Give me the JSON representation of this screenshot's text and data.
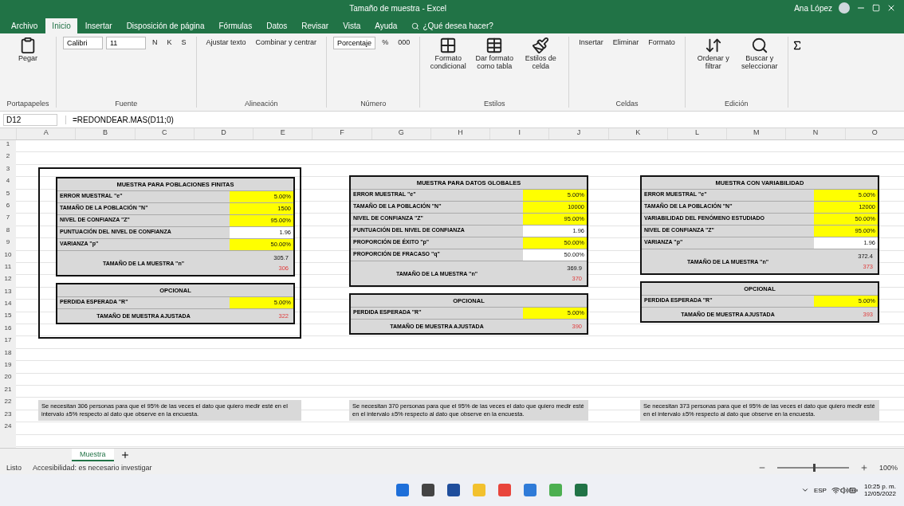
{
  "window": {
    "title": "Tamaño de muestra - Excel",
    "user": "Ana López"
  },
  "menu_tabs": [
    {
      "label": "Archivo",
      "selected": false
    },
    {
      "label": "Inicio",
      "selected": true
    },
    {
      "label": "Insertar",
      "selected": false
    },
    {
      "label": "Disposición de página",
      "selected": false
    },
    {
      "label": "Fórmulas",
      "selected": false
    },
    {
      "label": "Datos",
      "selected": false
    },
    {
      "label": "Revisar",
      "selected": false
    },
    {
      "label": "Vista",
      "selected": false
    },
    {
      "label": "Ayuda",
      "selected": false
    }
  ],
  "tell_me": "¿Qué desea hacer?",
  "ribbon": [
    {
      "label": "Portapapeles",
      "items": [
        {
          "kind": "big",
          "label": "Pegar"
        }
      ]
    },
    {
      "label": "Fuente",
      "items": [
        {
          "kind": "field",
          "label": "Calibri"
        },
        {
          "kind": "field",
          "label": "11"
        },
        {
          "kind": "small",
          "label": "N"
        },
        {
          "kind": "small",
          "label": "K"
        },
        {
          "kind": "small",
          "label": "S"
        }
      ]
    },
    {
      "label": "Alineación",
      "items": [
        {
          "kind": "small",
          "label": "Ajustar texto"
        },
        {
          "kind": "small",
          "label": "Combinar y centrar"
        }
      ]
    },
    {
      "label": "Número",
      "items": [
        {
          "kind": "field",
          "label": "Porcentaje"
        },
        {
          "kind": "small",
          "label": "%"
        },
        {
          "kind": "small",
          "label": "000"
        }
      ]
    },
    {
      "label": "Estilos",
      "items": [
        {
          "kind": "big",
          "label": "Formato condicional"
        },
        {
          "kind": "big",
          "label": "Dar formato como tabla"
        },
        {
          "kind": "big",
          "label": "Estilos de celda"
        }
      ]
    },
    {
      "label": "Celdas",
      "items": [
        {
          "kind": "small",
          "label": "Insertar"
        },
        {
          "kind": "small",
          "label": "Eliminar"
        },
        {
          "kind": "small",
          "label": "Formato"
        }
      ]
    },
    {
      "label": "Edición",
      "items": [
        {
          "kind": "big",
          "label": "Ordenar y filtrar"
        },
        {
          "kind": "big",
          "label": "Buscar y seleccionar"
        }
      ]
    }
  ],
  "formula_bar": {
    "cell": "D12",
    "formula": "=REDONDEAR.MAS(D11;0)"
  },
  "columns": [
    "A",
    "B",
    "C",
    "D",
    "E",
    "F",
    "G",
    "H",
    "I",
    "J",
    "K",
    "L",
    "M",
    "N",
    "O"
  ],
  "rows": [
    "1",
    "2",
    "3",
    "4",
    "5",
    "6",
    "7",
    "8",
    "9",
    "10",
    "11",
    "12",
    "13",
    "14",
    "15",
    "16",
    "17",
    "18",
    "19",
    "20",
    "21",
    "22",
    "23",
    "24"
  ],
  "tables": [
    {
      "framed": true,
      "title": "MUESTRA PARA POBLACIONES FINITAS",
      "rows": [
        {
          "label": "ERROR MUESTRAL \"e\"",
          "value": "5.00%",
          "kind": "input"
        },
        {
          "label": "TAMAÑO DE LA POBLACIÓN \"N\"",
          "value": "1500",
          "kind": "input"
        },
        {
          "label": "NIVEL DE CONFIANZA \"Z\"",
          "value": "95.00%",
          "kind": "input"
        },
        {
          "label": "PUNTUACIÓN DEL NIVEL DE CONFIANZA",
          "value": "1.96",
          "kind": "plain"
        },
        {
          "label": "VARIANZA \"p\"",
          "value": "50.00%",
          "kind": "input"
        }
      ],
      "result": {
        "label": "TAMAÑO DE LA MUESTRA \"n\"",
        "values": [
          "305.7",
          "306"
        ]
      },
      "optional": {
        "title": "OPCIONAL",
        "rows": [
          {
            "label": "PERDIDA ESPERADA \"R\"",
            "value": "5.00%",
            "kind": "input"
          }
        ],
        "result": {
          "label": "TAMAÑO DE MUESTRA AJUSTADA",
          "values": [
            "322"
          ]
        }
      },
      "note": "Se necesitan 306 personas para que el 95% de las veces el dato que quiero medir esté en el intervalo ±5% respecto al dato que observe en la encuesta."
    },
    {
      "framed": false,
      "title": "MUESTRA PARA DATOS GLOBALES",
      "rows": [
        {
          "label": "ERROR MUESTRAL \"e\"",
          "value": "5.00%",
          "kind": "input"
        },
        {
          "label": "TAMAÑO DE LA POBLACIÓN \"N\"",
          "value": "10000",
          "kind": "input"
        },
        {
          "label": "NIVEL DE CONFIANZA \"Z\"",
          "value": "95.00%",
          "kind": "input"
        },
        {
          "label": "PUNTUACIÓN DEL NIVEL DE CONFIANZA",
          "value": "1.96",
          "kind": "plain"
        },
        {
          "label": "PROPORCIÓN DE ÉXITO \"p\"",
          "value": "50.00%",
          "kind": "input"
        },
        {
          "label": "PROPORCIÓN DE FRACASO \"q\"",
          "value": "50.00%",
          "kind": "plain"
        }
      ],
      "result": {
        "label": "TAMAÑO DE LA MUESTRA \"n\"",
        "values": [
          "369.9",
          "370"
        ]
      },
      "optional": {
        "title": "OPCIONAL",
        "rows": [
          {
            "label": "PERDIDA ESPERADA \"R\"",
            "value": "5.00%",
            "kind": "input"
          }
        ],
        "result": {
          "label": "TAMAÑO DE MUESTRA AJUSTADA",
          "values": [
            "390"
          ]
        }
      },
      "note": "Se necesitan 370 personas para que el 95% de las veces el dato que quiero medir esté en el intervalo ±5% respecto al dato que observe en la encuesta."
    },
    {
      "framed": false,
      "title": "MUESTRA CON VARIABILIDAD",
      "rows": [
        {
          "label": "ERROR MUESTRAL \"e\"",
          "value": "5.00%",
          "kind": "input"
        },
        {
          "label": "TAMAÑO DE LA POBLACIÓN \"N\"",
          "value": "12000",
          "kind": "input"
        },
        {
          "label": "VARIABILIDAD DEL FENÓMENO ESTUDIADO",
          "value": "50.00%",
          "kind": "input"
        },
        {
          "label": "NIVEL DE CONFIANZA \"Z\"",
          "value": "95.00%",
          "kind": "input"
        },
        {
          "label": "VARIANZA \"p\"",
          "value": "1.96",
          "kind": "plain"
        }
      ],
      "result": {
        "label": "TAMAÑO DE LA MUESTRA \"n\"",
        "values": [
          "372.4",
          "373"
        ]
      },
      "optional": {
        "title": "OPCIONAL",
        "rows": [
          {
            "label": "PERDIDA ESPERADA \"R\"",
            "value": "5.00%",
            "kind": "input"
          }
        ],
        "result": {
          "label": "TAMAÑO DE MUESTRA AJUSTADA",
          "values": [
            "393"
          ]
        }
      },
      "note": "Se necesitan 373 personas para que el 95% de las veces el dato que quiero medir esté en el intervalo ±5% respecto al dato que observe en la encuesta."
    }
  ],
  "sheet_tabs": [
    {
      "label": "Muestra",
      "selected": true
    }
  ],
  "status": {
    "mode": "Listo",
    "accessibility": "Accesibilidad: es necesario investigar",
    "zoom": "100%",
    "zoom_slider": {
      "level": 0.5
    }
  },
  "tray": {
    "language": "ESP",
    "time": "10:25 p. m.",
    "date": "12/05/2022"
  }
}
